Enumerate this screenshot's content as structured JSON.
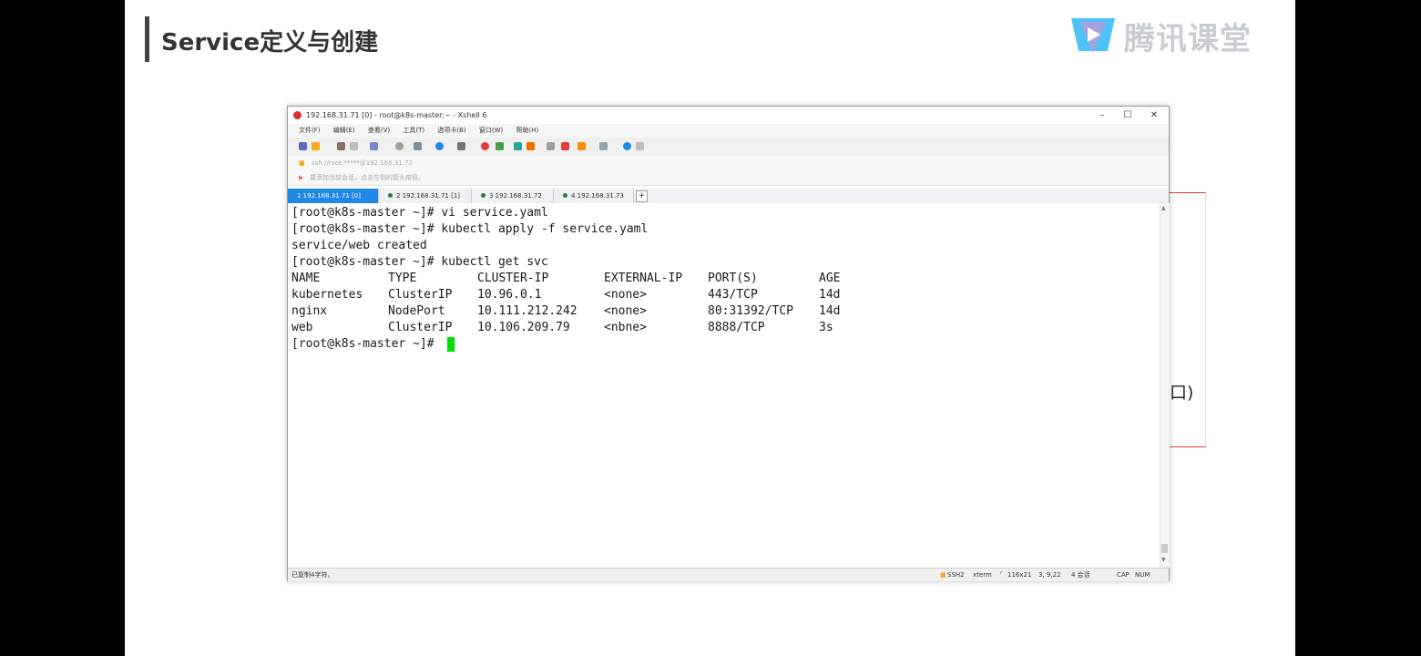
{
  "slide": {
    "title": "Service定义与创建",
    "brand": "腾讯课堂",
    "bg_text": "口)"
  },
  "window": {
    "title": "192.168.31.71 [0] - root@k8s-master:~ - Xshell 6",
    "controls": [
      "–",
      "☐",
      "✕"
    ],
    "menu": [
      "文件(F)",
      "编辑(E)",
      "查看(V)",
      "工具(T)",
      "选项卡(B)",
      "窗口(W)",
      "帮助(H)"
    ],
    "address": "ssh://root:*****@192.168.31.72",
    "hint": "要添加当前会话，点击左侧的箭头按钮。",
    "tabs": [
      {
        "label": "1 192.168.31.71 [0]",
        "active": true
      },
      {
        "label": "2 192.168.31.71 [1]",
        "active": false
      },
      {
        "label": "3 192.168.31.72",
        "active": false
      },
      {
        "label": "4 192.168.31.73",
        "active": false
      }
    ],
    "tab_add": "+",
    "status": {
      "left": "已复制4字符。",
      "ssh": "SSH2",
      "term": "xterm",
      "size": "116x21",
      "pos": "3, 9,22",
      "sessions": "4 会话",
      "caps": "CAP",
      "num": "NUM"
    }
  },
  "terminal": {
    "lines": [
      "[root@k8s-master ~]# vi service.yaml",
      "[root@k8s-master ~]# kubectl apply -f service.yaml",
      "service/web created",
      "[root@k8s-master ~]# kubectl get svc"
    ],
    "table_headers": [
      "NAME",
      "TYPE",
      "CLUSTER-IP",
      "EXTERNAL-IP",
      "PORT(S)",
      "AGE"
    ],
    "table_rows": [
      [
        "kubernetes",
        "ClusterIP",
        "10.96.0.1",
        "<none>",
        "443/TCP",
        "14d"
      ],
      [
        "nginx",
        "NodePort",
        "10.111.212.242",
        "<none>",
        "80:31392/TCP",
        "14d"
      ],
      [
        "web",
        "ClusterIP",
        "10.106.209.79",
        "<nbne>",
        "8888/TCP",
        "3s"
      ]
    ],
    "prompt": "[root@k8s-master ~]# ",
    "colors": {
      "cursor": "#00e000",
      "text": "#1a1a1a"
    }
  }
}
